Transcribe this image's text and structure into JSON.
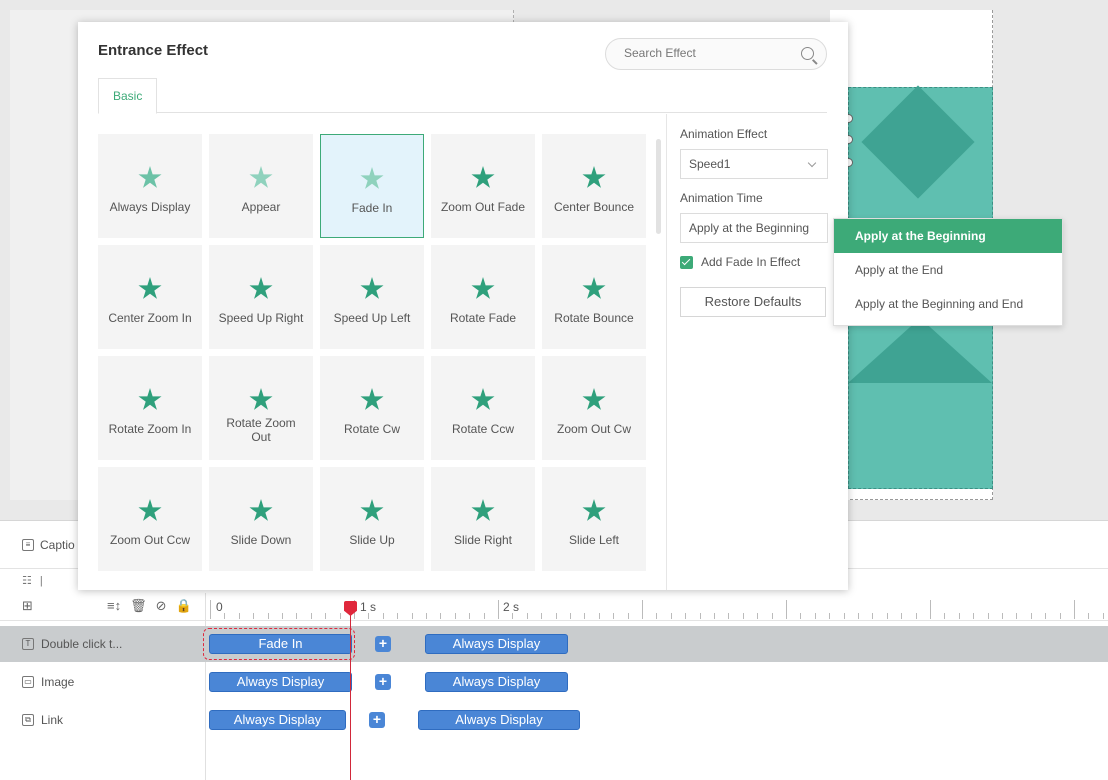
{
  "dialog": {
    "title": "Entrance Effect",
    "search_placeholder": "Search Effect",
    "tabs": [
      {
        "label": "Basic",
        "active": true
      }
    ],
    "effects": [
      {
        "label": "Always Display",
        "icon": "star-icon"
      },
      {
        "label": "Appear",
        "icon": "star-icon"
      },
      {
        "label": "Fade In",
        "icon": "star-icon",
        "selected": true
      },
      {
        "label": "Zoom Out Fade",
        "icon": "star-zoom-out-icon"
      },
      {
        "label": "Center Bounce",
        "icon": "star-bounce-icon"
      },
      {
        "label": "Center Zoom In",
        "icon": "star-zoom-in-icon"
      },
      {
        "label": "Speed Up Right",
        "icon": "star-speed-right-icon"
      },
      {
        "label": "Speed Up Left",
        "icon": "star-speed-left-icon"
      },
      {
        "label": "Rotate Fade",
        "icon": "star-rotate-fade-icon"
      },
      {
        "label": "Rotate Bounce",
        "icon": "star-rotate-bounce-icon"
      },
      {
        "label": "Rotate Zoom In",
        "icon": "star-rotate-zoom-in-icon"
      },
      {
        "label": "Rotate Zoom Out",
        "icon": "star-rotate-zoom-out-icon"
      },
      {
        "label": "Rotate Cw",
        "icon": "star-rotate-cw-icon"
      },
      {
        "label": "Rotate Ccw",
        "icon": "star-rotate-ccw-icon"
      },
      {
        "label": "Zoom Out Cw",
        "icon": "star-zoom-out-cw-icon"
      },
      {
        "label": "Zoom Out Ccw",
        "icon": "star-zoom-out-ccw-icon"
      },
      {
        "label": "Slide Down",
        "icon": "star-slide-down-icon"
      },
      {
        "label": "Slide Up",
        "icon": "star-slide-up-icon"
      },
      {
        "label": "Slide Right",
        "icon": "star-slide-right-icon"
      },
      {
        "label": "Slide Left",
        "icon": "star-slide-left-icon"
      }
    ]
  },
  "settings": {
    "animation_effect_label": "Animation Effect",
    "animation_effect_value": "Speed1",
    "animation_time_label": "Animation Time",
    "animation_time_value": "Apply at the Beginning",
    "fade_in_label": "Add Fade In Effect",
    "fade_in_checked": true,
    "restore_label": "Restore Defaults"
  },
  "time_menu": {
    "options": [
      "Apply at the Beginning",
      "Apply at the End",
      "Apply at the Beginning and End"
    ],
    "active_index": 0
  },
  "timeline": {
    "caption_label": "Captio",
    "ruler_labels": [
      "0",
      "1 s",
      "2 s"
    ],
    "tracks": [
      {
        "label": "Double click t...",
        "icon": "text-icon",
        "clips": [
          "Fade In",
          "Always Display"
        ],
        "selected": true
      },
      {
        "label": "Image",
        "icon": "image-icon",
        "clips": [
          "Always Display",
          "Always Display"
        ]
      },
      {
        "label": "Link",
        "icon": "link-icon",
        "clips": [
          "Always Display",
          "Always Display"
        ]
      }
    ],
    "add_button_label": "+"
  },
  "colors": {
    "accent": "#3daa78",
    "clip_blue": "#4a86d6",
    "playhead_red": "#e0283c",
    "shape_teal": "#5fbfb0"
  }
}
